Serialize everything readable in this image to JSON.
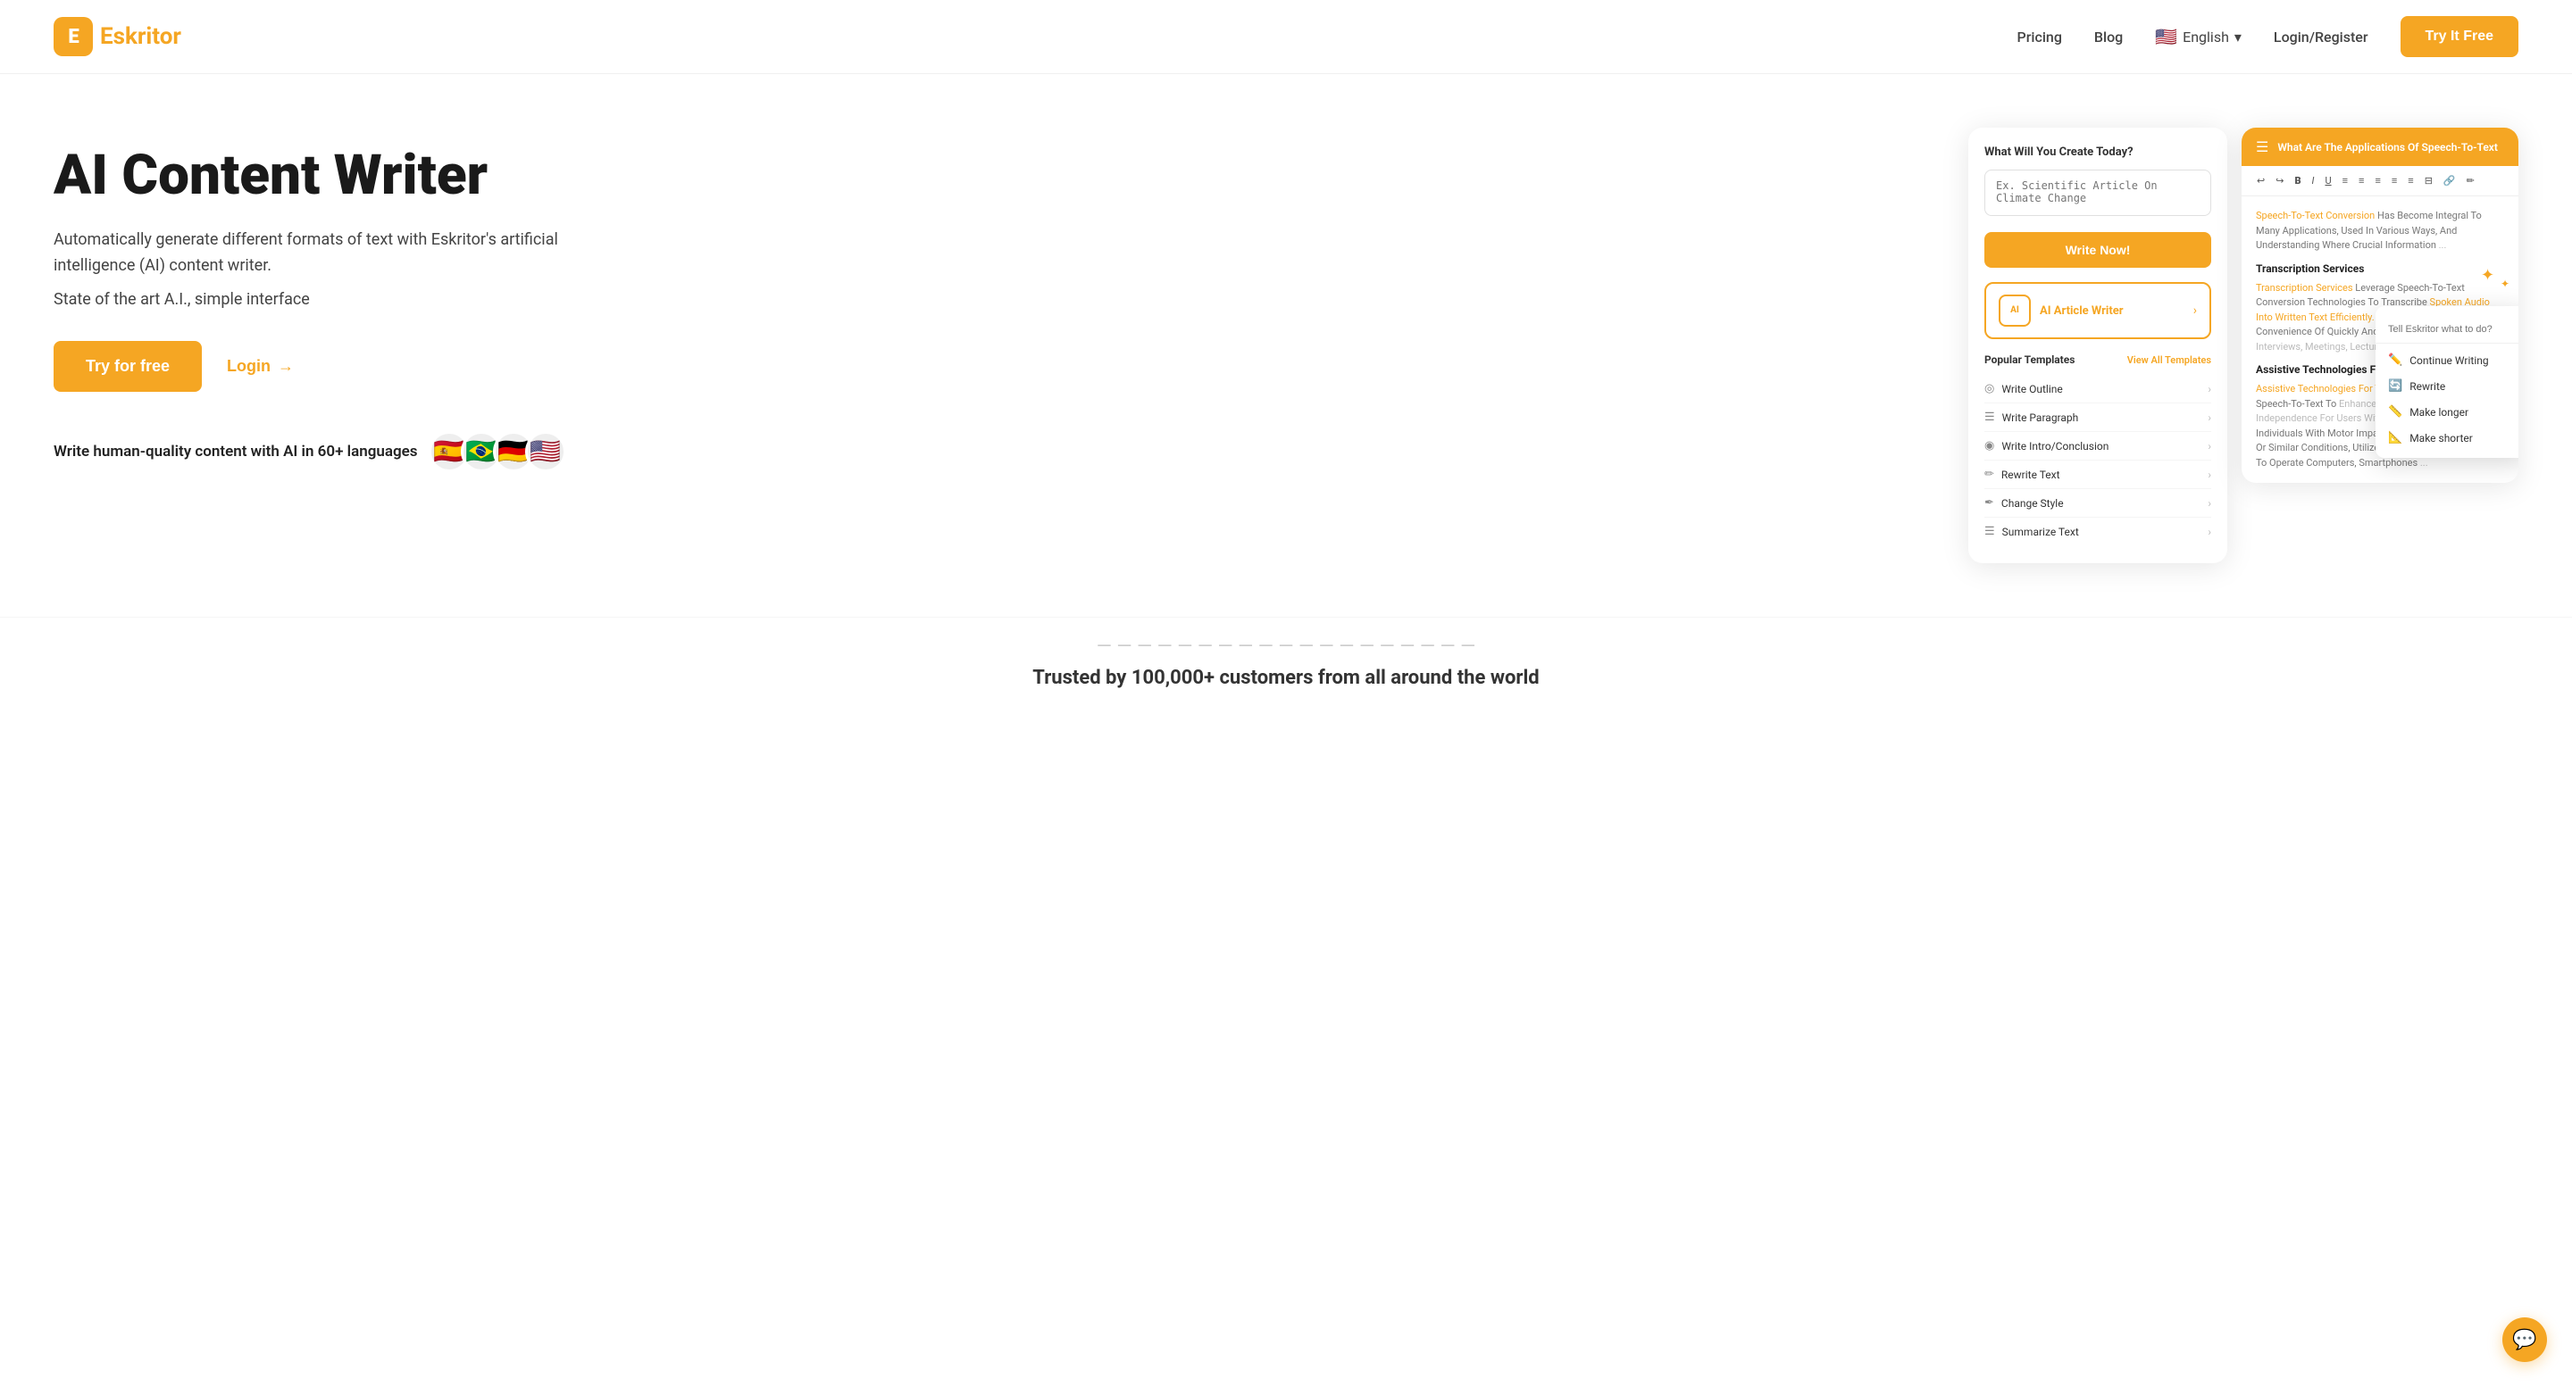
{
  "nav": {
    "logo_letter": "E",
    "logo_name": "skritor",
    "links": [
      {
        "label": "Pricing",
        "href": "#"
      },
      {
        "label": "Blog",
        "href": "#"
      }
    ],
    "language": "English",
    "login_label": "Login/Register",
    "cta_label": "Try It Free"
  },
  "hero": {
    "title": "AI Content Writer",
    "desc": "Automatically generate different formats of text with Eskritor's artificial intelligence (AI) content writer.",
    "sub": "State of the art A.I., simple interface",
    "btn_primary": "Try for free",
    "btn_secondary": "Login",
    "langs_label": "Write human-quality content with AI in 60+ languages",
    "flags": [
      "🇪🇸",
      "🇧🇷",
      "🇩🇪",
      "🇺🇸"
    ]
  },
  "card1": {
    "question": "What Will You Create Today?",
    "placeholder": "Ex. Scientific Article On Climate Change",
    "write_now": "Write Now!",
    "ai_article_label": "AI Article Writer",
    "popular_label": "Popular Templates",
    "view_all": "View All Templates",
    "templates": [
      {
        "icon": "◎",
        "label": "Write Outline"
      },
      {
        "icon": "☰",
        "label": "Write Paragraph"
      },
      {
        "icon": "◉",
        "label": "Write Intro/Conclusion"
      },
      {
        "icon": "✏️",
        "label": "Rewrite Text"
      },
      {
        "icon": "✒️",
        "label": "Change Style"
      },
      {
        "icon": "☰",
        "label": "Summarize Text"
      }
    ]
  },
  "card2": {
    "title": "What Are The Applications Of Speech-To-Text",
    "toolbar": [
      "↩",
      "↪",
      "B",
      "I",
      "U",
      "≡",
      "≡",
      "≡",
      "≡",
      "≡",
      "⊟",
      "🔗",
      "✏"
    ],
    "body": {
      "intro": "Speech-To-Text Conversion Has Become Integral To Many Applications, Used In Various Ways, And Understanding Where Crucial Information",
      "section1_title": "Transcription Services",
      "section1_text": "Transcription Services Leverage Speech-To-Text Conversion Technologies To Transcribe Spoken Audio Into Written Text Efficiently. Editors Benefit From The Convenience Of Quickly And Accurately Transcribing Interviews, Meetings, Lectures, And Other Audio Content. The Convenience Of Quickly And Accurately Transcribing Audio Files Proves Extremely Beneficial, Saving Time And Effort.",
      "section2_title": "Assistive Technologies For The Disabled",
      "section2_text": "Assistive Technologies For The Disabled Leverage Speech-To-Text To Enhance Accessibility And Independence For Users With Disabilities. Individuals With Motor Impairments, Such As Paralysis Or Similar Conditions, Utilize Speech-To-Text Converters To Operate Computers, Smartphones"
    }
  },
  "context_menu": {
    "placeholder": "Tell Eskritor what to do?",
    "items": [
      {
        "icon": "✏️",
        "label": "Continue Writing"
      },
      {
        "icon": "🔄",
        "label": "Rewrite"
      },
      {
        "icon": "📏",
        "label": "Make longer"
      },
      {
        "icon": "📐",
        "label": "Make shorter"
      }
    ]
  },
  "trusted": {
    "label": "Trusted by 100,000+ customers from all around the world"
  }
}
